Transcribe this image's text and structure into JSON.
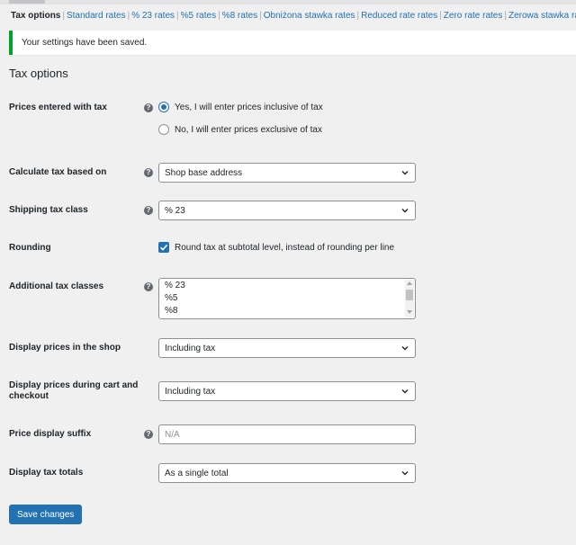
{
  "tabs": [
    {
      "label": "Tax options"
    },
    {
      "label": "Standard rates"
    },
    {
      "label": "% 23 rates"
    },
    {
      "label": "%5 rates"
    },
    {
      "label": "%8 rates"
    },
    {
      "label": "Obniżona stawka rates"
    },
    {
      "label": "Reduced rate rates"
    },
    {
      "label": "Zero rate rates"
    },
    {
      "label": "Zerowa stawka rates"
    }
  ],
  "notice": {
    "text": "Your settings have been saved."
  },
  "section_title": "Tax options",
  "prices_entered_with_tax": {
    "label": "Prices entered with tax",
    "options": [
      {
        "label": "Yes, I will enter prices inclusive of tax",
        "checked": true
      },
      {
        "label": "No, I will enter prices exclusive of tax",
        "checked": false
      }
    ]
  },
  "calculate_tax_based_on": {
    "label": "Calculate tax based on",
    "value": "Shop base address"
  },
  "shipping_tax_class": {
    "label": "Shipping tax class",
    "value": "% 23"
  },
  "rounding": {
    "label": "Rounding",
    "checkbox_label": "Round tax at subtotal level, instead of rounding per line",
    "checked": true
  },
  "additional_tax_classes": {
    "label": "Additional tax classes",
    "lines": [
      "% 23",
      "%5",
      "%8"
    ]
  },
  "display_prices_shop": {
    "label": "Display prices in the shop",
    "value": "Including tax"
  },
  "display_prices_cart": {
    "label_line1": "Display prices during cart and",
    "label_line2": "checkout",
    "value": "Including tax"
  },
  "price_display_suffix": {
    "label": "Price display suffix",
    "placeholder": "N/A",
    "value": ""
  },
  "display_tax_totals": {
    "label": "Display tax totals",
    "value": "As a single total"
  },
  "save_button": {
    "label": "Save changes"
  },
  "help_glyph": "?",
  "colors": {
    "accent": "#2271b1",
    "success": "#00a32a",
    "background": "#f0f0f1"
  },
  "icons": [
    "help-icon",
    "chevron-down-icon",
    "checkmark-icon"
  ]
}
